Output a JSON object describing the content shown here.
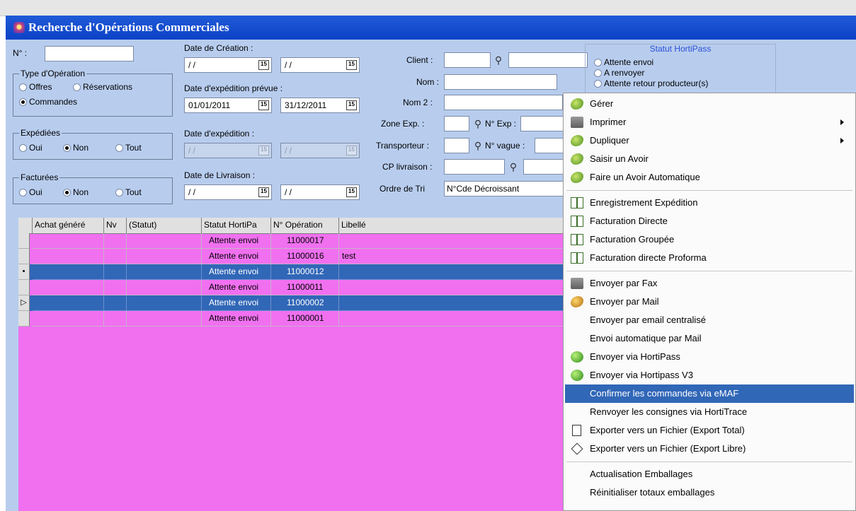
{
  "window": {
    "title": "Recherche d'Opérations Commerciales"
  },
  "form": {
    "num_label": "N° :",
    "num_value": "",
    "type_group": {
      "title": "Type d'Opération",
      "options": [
        "Offres",
        "Réservations",
        "Commandes"
      ],
      "selected": "Commandes"
    },
    "expediees_group": {
      "title": "Expédiées",
      "options": [
        "Oui",
        "Non",
        "Tout"
      ],
      "selected": "Non"
    },
    "facturees_group": {
      "title": "Facturées",
      "options": [
        "Oui",
        "Non",
        "Tout"
      ],
      "selected": "Non"
    },
    "date_creation": {
      "label": "Date de Création :",
      "from": "/ /",
      "to": "/ /"
    },
    "date_expedition_prevue": {
      "label": "Date d'expédition prévue :",
      "from": "01/01/2011",
      "to": "31/12/2011"
    },
    "date_expedition": {
      "label": "Date d'expédition :",
      "from": "/ /",
      "to": "/ /"
    },
    "date_livraison": {
      "label": "Date de Livraison :",
      "from": "/ /",
      "to": "/ /"
    },
    "calendar_glyph": "15",
    "client_label": "Client :",
    "nom_label": "Nom :",
    "nom2_label": "Nom 2 :",
    "zone_exp_label": "Zone Exp. :",
    "num_exp_label": "N° Exp :",
    "transporteur_label": "Transporteur :",
    "num_vague_label": "N° vague :",
    "cp_livraison_label": "CP livraison :",
    "ordre_tri_label": "Ordre de Tri",
    "ordre_tri_value": "N°Cde Décroissant",
    "statut_hortipass": {
      "title": "Statut HortiPass",
      "options": [
        "Attente envoi",
        "A renvoyer",
        "Attente retour producteur(s)"
      ]
    }
  },
  "grid": {
    "columns": [
      "Achat généré",
      "Nv",
      "(Statut)",
      "Statut HortiPa",
      "N° Opération",
      "Libellé"
    ],
    "rows": [
      {
        "statut": "Attente envoi",
        "num": "11000017",
        "libelle": "",
        "selected": false,
        "indicator": ""
      },
      {
        "statut": "Attente envoi",
        "num": "11000016",
        "libelle": "test",
        "selected": false,
        "indicator": ""
      },
      {
        "statut": "Attente envoi",
        "num": "11000012",
        "libelle": "",
        "selected": true,
        "indicator": "•"
      },
      {
        "statut": "Attente envoi",
        "num": "11000011",
        "libelle": "",
        "selected": false,
        "indicator": ""
      },
      {
        "statut": "Attente envoi",
        "num": "11000002",
        "libelle": "",
        "selected": true,
        "indicator": "▷"
      },
      {
        "statut": "Attente envoi",
        "num": "11000001",
        "libelle": "",
        "selected": false,
        "indicator": ""
      }
    ]
  },
  "context_menu": {
    "items": [
      {
        "label": "Gérer",
        "icon": "leaf-icon",
        "submenu": false
      },
      {
        "label": "Imprimer",
        "icon": "printer-icon",
        "submenu": true
      },
      {
        "label": "Dupliquer",
        "icon": "leaf-icon",
        "submenu": true
      },
      {
        "label": "Saisir un Avoir",
        "icon": "leaf-icon",
        "submenu": false
      },
      {
        "label": "Faire un Avoir Automatique",
        "icon": "leaf-icon",
        "submenu": false
      },
      {
        "label": "Enregistrement Expédition",
        "icon": "book-icon",
        "submenu": false
      },
      {
        "label": "Facturation Directe",
        "icon": "book-icon",
        "submenu": false
      },
      {
        "label": "Facturation Groupée",
        "icon": "book-icon",
        "submenu": false
      },
      {
        "label": "Facturation directe Proforma",
        "icon": "book-icon",
        "submenu": false
      },
      {
        "label": "Envoyer par Fax",
        "icon": "fax-icon",
        "submenu": false
      },
      {
        "label": "Envoyer par Mail",
        "icon": "mail-icon",
        "submenu": false
      },
      {
        "label": "Envoyer par email centralisé",
        "icon": "",
        "submenu": false
      },
      {
        "label": "Envoi automatique par Mail",
        "icon": "",
        "submenu": false
      },
      {
        "label": "Envoyer via HortiPass",
        "icon": "hortipass-icon",
        "submenu": false
      },
      {
        "label": "Envoyer via Hortipass V3",
        "icon": "hortipass-icon",
        "submenu": false
      },
      {
        "label": "Confirmer les commandes via eMAF",
        "icon": "",
        "submenu": false,
        "highlighted": true
      },
      {
        "label": "Renvoyer les consignes via HortiTrace",
        "icon": "",
        "submenu": false
      },
      {
        "label": "Exporter vers un Fichier (Export Total)",
        "icon": "document-icon",
        "submenu": false
      },
      {
        "label": "Exporter vers un Fichier (Export Libre)",
        "icon": "diamond-icon",
        "submenu": false
      },
      {
        "label": "Actualisation Emballages",
        "icon": "",
        "submenu": false
      },
      {
        "label": "Réinitialiser totaux emballages",
        "icon": "",
        "submenu": false
      }
    ]
  },
  "colors": {
    "title_bar": "#0c42c6",
    "form_bg": "#b8cdee",
    "grid_bg": "#f070f0",
    "selection": "#3167b7"
  }
}
